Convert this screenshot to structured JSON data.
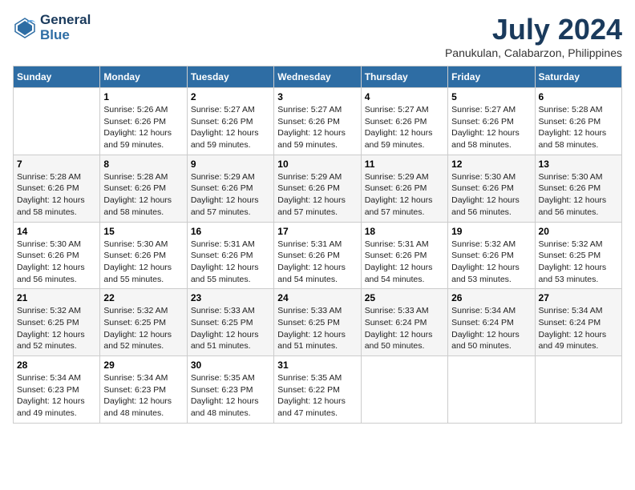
{
  "header": {
    "logo_line1": "General",
    "logo_line2": "Blue",
    "month": "July 2024",
    "location": "Panukulan, Calabarzon, Philippines"
  },
  "days_of_week": [
    "Sunday",
    "Monday",
    "Tuesday",
    "Wednesday",
    "Thursday",
    "Friday",
    "Saturday"
  ],
  "weeks": [
    [
      {
        "num": "",
        "sunrise": "",
        "sunset": "",
        "daylight": ""
      },
      {
        "num": "1",
        "sunrise": "Sunrise: 5:26 AM",
        "sunset": "Sunset: 6:26 PM",
        "daylight": "Daylight: 12 hours and 59 minutes."
      },
      {
        "num": "2",
        "sunrise": "Sunrise: 5:27 AM",
        "sunset": "Sunset: 6:26 PM",
        "daylight": "Daylight: 12 hours and 59 minutes."
      },
      {
        "num": "3",
        "sunrise": "Sunrise: 5:27 AM",
        "sunset": "Sunset: 6:26 PM",
        "daylight": "Daylight: 12 hours and 59 minutes."
      },
      {
        "num": "4",
        "sunrise": "Sunrise: 5:27 AM",
        "sunset": "Sunset: 6:26 PM",
        "daylight": "Daylight: 12 hours and 59 minutes."
      },
      {
        "num": "5",
        "sunrise": "Sunrise: 5:27 AM",
        "sunset": "Sunset: 6:26 PM",
        "daylight": "Daylight: 12 hours and 58 minutes."
      },
      {
        "num": "6",
        "sunrise": "Sunrise: 5:28 AM",
        "sunset": "Sunset: 6:26 PM",
        "daylight": "Daylight: 12 hours and 58 minutes."
      }
    ],
    [
      {
        "num": "7",
        "sunrise": "Sunrise: 5:28 AM",
        "sunset": "Sunset: 6:26 PM",
        "daylight": "Daylight: 12 hours and 58 minutes."
      },
      {
        "num": "8",
        "sunrise": "Sunrise: 5:28 AM",
        "sunset": "Sunset: 6:26 PM",
        "daylight": "Daylight: 12 hours and 58 minutes."
      },
      {
        "num": "9",
        "sunrise": "Sunrise: 5:29 AM",
        "sunset": "Sunset: 6:26 PM",
        "daylight": "Daylight: 12 hours and 57 minutes."
      },
      {
        "num": "10",
        "sunrise": "Sunrise: 5:29 AM",
        "sunset": "Sunset: 6:26 PM",
        "daylight": "Daylight: 12 hours and 57 minutes."
      },
      {
        "num": "11",
        "sunrise": "Sunrise: 5:29 AM",
        "sunset": "Sunset: 6:26 PM",
        "daylight": "Daylight: 12 hours and 57 minutes."
      },
      {
        "num": "12",
        "sunrise": "Sunrise: 5:30 AM",
        "sunset": "Sunset: 6:26 PM",
        "daylight": "Daylight: 12 hours and 56 minutes."
      },
      {
        "num": "13",
        "sunrise": "Sunrise: 5:30 AM",
        "sunset": "Sunset: 6:26 PM",
        "daylight": "Daylight: 12 hours and 56 minutes."
      }
    ],
    [
      {
        "num": "14",
        "sunrise": "Sunrise: 5:30 AM",
        "sunset": "Sunset: 6:26 PM",
        "daylight": "Daylight: 12 hours and 56 minutes."
      },
      {
        "num": "15",
        "sunrise": "Sunrise: 5:30 AM",
        "sunset": "Sunset: 6:26 PM",
        "daylight": "Daylight: 12 hours and 55 minutes."
      },
      {
        "num": "16",
        "sunrise": "Sunrise: 5:31 AM",
        "sunset": "Sunset: 6:26 PM",
        "daylight": "Daylight: 12 hours and 55 minutes."
      },
      {
        "num": "17",
        "sunrise": "Sunrise: 5:31 AM",
        "sunset": "Sunset: 6:26 PM",
        "daylight": "Daylight: 12 hours and 54 minutes."
      },
      {
        "num": "18",
        "sunrise": "Sunrise: 5:31 AM",
        "sunset": "Sunset: 6:26 PM",
        "daylight": "Daylight: 12 hours and 54 minutes."
      },
      {
        "num": "19",
        "sunrise": "Sunrise: 5:32 AM",
        "sunset": "Sunset: 6:26 PM",
        "daylight": "Daylight: 12 hours and 53 minutes."
      },
      {
        "num": "20",
        "sunrise": "Sunrise: 5:32 AM",
        "sunset": "Sunset: 6:25 PM",
        "daylight": "Daylight: 12 hours and 53 minutes."
      }
    ],
    [
      {
        "num": "21",
        "sunrise": "Sunrise: 5:32 AM",
        "sunset": "Sunset: 6:25 PM",
        "daylight": "Daylight: 12 hours and 52 minutes."
      },
      {
        "num": "22",
        "sunrise": "Sunrise: 5:32 AM",
        "sunset": "Sunset: 6:25 PM",
        "daylight": "Daylight: 12 hours and 52 minutes."
      },
      {
        "num": "23",
        "sunrise": "Sunrise: 5:33 AM",
        "sunset": "Sunset: 6:25 PM",
        "daylight": "Daylight: 12 hours and 51 minutes."
      },
      {
        "num": "24",
        "sunrise": "Sunrise: 5:33 AM",
        "sunset": "Sunset: 6:25 PM",
        "daylight": "Daylight: 12 hours and 51 minutes."
      },
      {
        "num": "25",
        "sunrise": "Sunrise: 5:33 AM",
        "sunset": "Sunset: 6:24 PM",
        "daylight": "Daylight: 12 hours and 50 minutes."
      },
      {
        "num": "26",
        "sunrise": "Sunrise: 5:34 AM",
        "sunset": "Sunset: 6:24 PM",
        "daylight": "Daylight: 12 hours and 50 minutes."
      },
      {
        "num": "27",
        "sunrise": "Sunrise: 5:34 AM",
        "sunset": "Sunset: 6:24 PM",
        "daylight": "Daylight: 12 hours and 49 minutes."
      }
    ],
    [
      {
        "num": "28",
        "sunrise": "Sunrise: 5:34 AM",
        "sunset": "Sunset: 6:23 PM",
        "daylight": "Daylight: 12 hours and 49 minutes."
      },
      {
        "num": "29",
        "sunrise": "Sunrise: 5:34 AM",
        "sunset": "Sunset: 6:23 PM",
        "daylight": "Daylight: 12 hours and 48 minutes."
      },
      {
        "num": "30",
        "sunrise": "Sunrise: 5:35 AM",
        "sunset": "Sunset: 6:23 PM",
        "daylight": "Daylight: 12 hours and 48 minutes."
      },
      {
        "num": "31",
        "sunrise": "Sunrise: 5:35 AM",
        "sunset": "Sunset: 6:22 PM",
        "daylight": "Daylight: 12 hours and 47 minutes."
      },
      {
        "num": "",
        "sunrise": "",
        "sunset": "",
        "daylight": ""
      },
      {
        "num": "",
        "sunrise": "",
        "sunset": "",
        "daylight": ""
      },
      {
        "num": "",
        "sunrise": "",
        "sunset": "",
        "daylight": ""
      }
    ]
  ]
}
